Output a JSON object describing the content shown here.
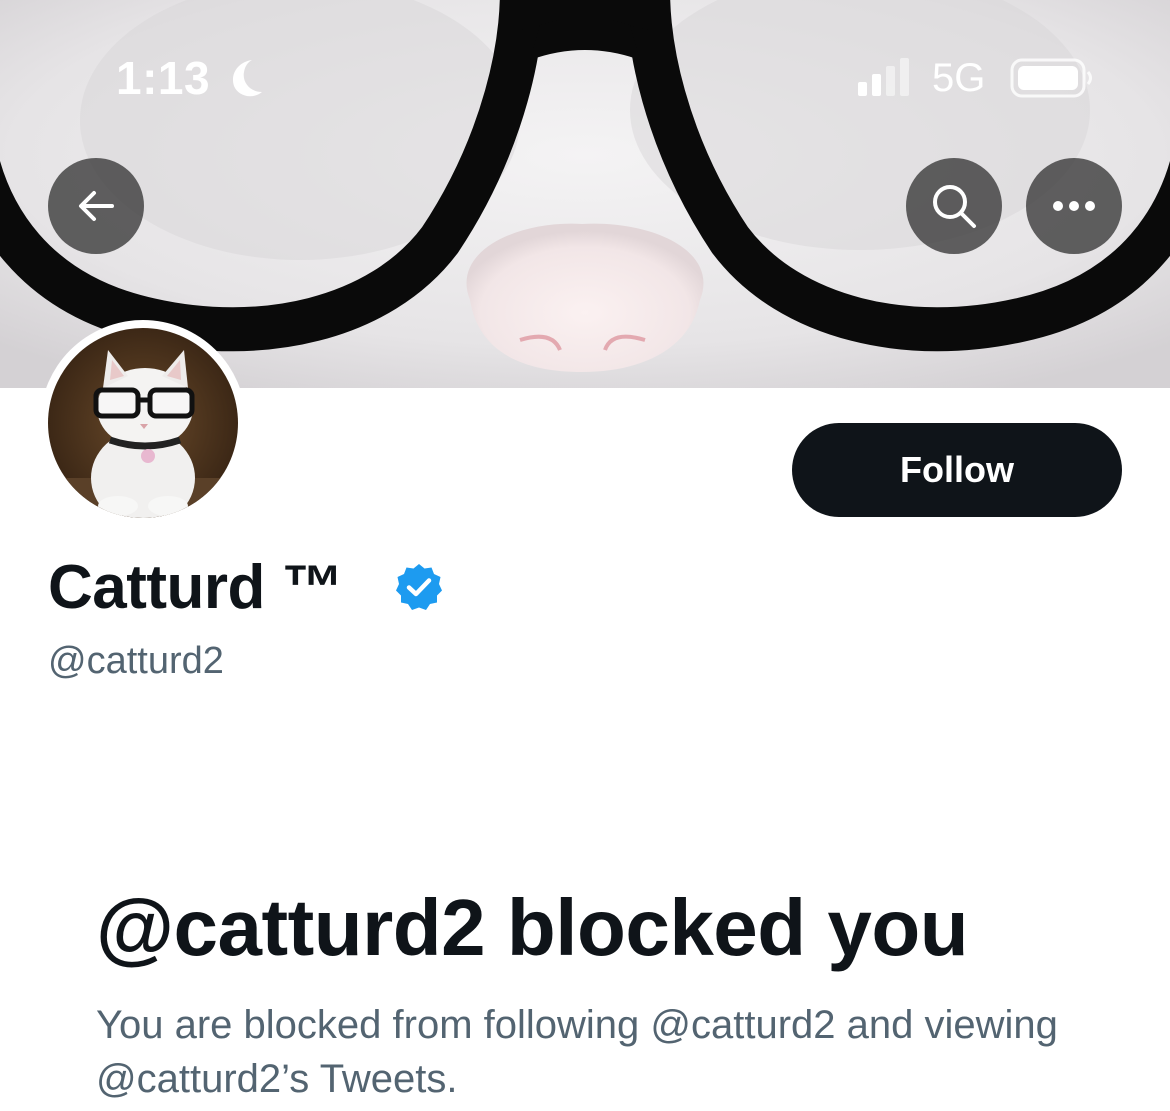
{
  "status_bar": {
    "time": "1:13",
    "network": "5G",
    "icons": [
      "moon-icon",
      "signal-icon",
      "battery-icon"
    ]
  },
  "header": {
    "back_icon": "arrow-left-icon",
    "search_icon": "search-icon",
    "more_icon": "more-horizontal-icon"
  },
  "profile": {
    "display_name": "Catturd ™",
    "handle": "@catturd2",
    "verified_icon": "verified-badge-icon",
    "follow_label": "Follow"
  },
  "blocked": {
    "title": "@catturd2 blocked you",
    "description": "You are blocked from following @catturd2 and viewing @catturd2’s Tweets."
  },
  "colors": {
    "primary_text": "#0f1419",
    "secondary_text": "#536471",
    "verified_blue": "#1d9bf0",
    "follow_button_bg": "#0f1419"
  }
}
